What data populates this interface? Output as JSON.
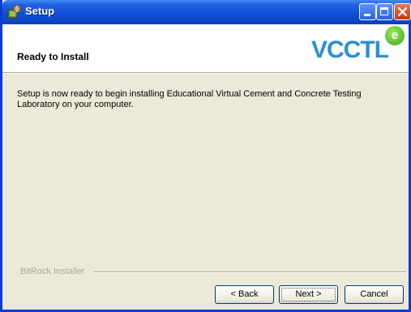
{
  "window": {
    "title": "Setup"
  },
  "header": {
    "title": "Ready to Install",
    "logo_text": "VCCTL",
    "logo_badge": "e"
  },
  "content": {
    "message": "Setup is now ready to begin installing Educational Virtual Cement and Concrete Testing Laboratory on your computer."
  },
  "footer": {
    "installer_label": "BitRock Installer"
  },
  "buttons": {
    "back": "< Back",
    "next": "Next >",
    "cancel": "Cancel"
  },
  "colors": {
    "titlebar": "#0d46c7",
    "face": "#ece9d8",
    "logo_blue": "#2a8fd6",
    "logo_green": "#3aa61c",
    "close_red": "#c63a16"
  }
}
